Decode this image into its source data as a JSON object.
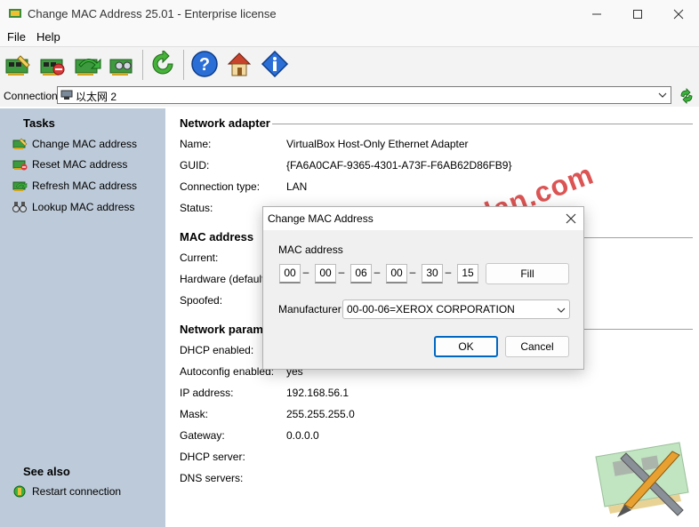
{
  "window": {
    "title": "Change MAC Address 25.01 - Enterprise license"
  },
  "menu": {
    "file": "File",
    "help": "Help"
  },
  "toolbar": {
    "buttons": [
      "change-mac-icon",
      "reset-mac-icon",
      "refresh-mac-icon",
      "lookup-mac-icon",
      "refresh-icon",
      "help-icon",
      "home-icon",
      "info-icon"
    ]
  },
  "connection": {
    "label": "Connection:",
    "value": "以太网 2"
  },
  "tasks": {
    "heading": "Tasks",
    "items": [
      "Change MAC address",
      "Reset MAC address",
      "Refresh MAC address",
      "Lookup MAC address"
    ]
  },
  "see_also": {
    "heading": "See also",
    "items": [
      "Restart connection"
    ]
  },
  "network_adapter": {
    "heading": "Network adapter",
    "name_label": "Name:",
    "name_value": "VirtualBox Host-Only Ethernet Adapter",
    "guid_label": "GUID:",
    "guid_value": "{FA6A0CAF-9365-4301-A73F-F6AB62D86FB9}",
    "type_label": "Connection type:",
    "type_value": "LAN",
    "status_label": "Status:"
  },
  "mac_section": {
    "heading": "MAC address",
    "current_label": "Current:",
    "hardware_label": "Hardware (default):",
    "spoofed_label": "Spoofed:"
  },
  "network_params": {
    "heading": "Network paramet",
    "dhcp_label": "DHCP enabled:",
    "autoconfig_label": "Autoconfig enabled:",
    "autoconfig_value": "yes",
    "ip_label": "IP address:",
    "ip_value": "192.168.56.1",
    "mask_label": "Mask:",
    "mask_value": "255.255.255.0",
    "gateway_label": "Gateway:",
    "gateway_value": "0.0.0.0",
    "dhcp_server_label": "DHCP server:",
    "dns_label": "DNS servers:"
  },
  "dialog": {
    "title": "Change MAC Address",
    "mac_label": "MAC address",
    "octets": [
      "00",
      "00",
      "06",
      "00",
      "30",
      "15"
    ],
    "fill_label": "Fill",
    "manufacturer_label": "Manufacturer",
    "manufacturer_value": "00-00-06=XEROX CORPORATION",
    "ok_label": "OK",
    "cancel_label": "Cancel"
  },
  "watermark": {
    "text": "wklan.com"
  },
  "colors": {
    "left_panel": "#bdcad9",
    "accent": "#0067c0",
    "watermark": "#d63636"
  }
}
